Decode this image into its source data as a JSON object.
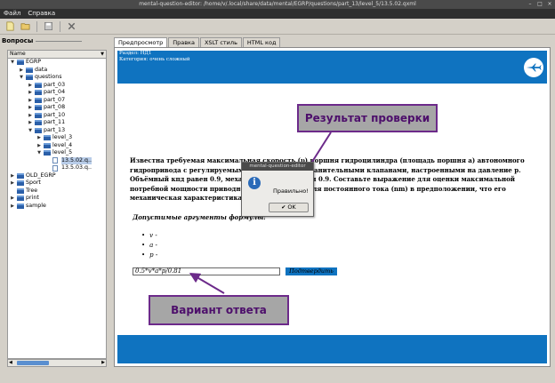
{
  "window": {
    "title": "mental-question-editor: /home/v/.local/share/data/mental/EGRP/questions/part_13/level_5/13.5.02.qxml"
  },
  "menu": [
    "Файл",
    "Справка"
  ],
  "toolbar": {
    "icons": [
      "new-file-icon",
      "open-file-icon",
      "save-icon",
      "delete-icon"
    ]
  },
  "left_panel": {
    "title": "Вопросы",
    "column": "Name",
    "tree": [
      {
        "label": "EGRP",
        "level": 0,
        "arrow": "down",
        "type": "folder"
      },
      {
        "label": "data",
        "level": 1,
        "arrow": "right",
        "type": "folder"
      },
      {
        "label": "questions",
        "level": 1,
        "arrow": "down",
        "type": "folder"
      },
      {
        "label": "part_03",
        "level": 2,
        "arrow": "right",
        "type": "folder"
      },
      {
        "label": "part_04",
        "level": 2,
        "arrow": "right",
        "type": "folder"
      },
      {
        "label": "part_07",
        "level": 2,
        "arrow": "right",
        "type": "folder"
      },
      {
        "label": "part_08",
        "level": 2,
        "arrow": "right",
        "type": "folder"
      },
      {
        "label": "part_10",
        "level": 2,
        "arrow": "right",
        "type": "folder"
      },
      {
        "label": "part_11",
        "level": 2,
        "arrow": "right",
        "type": "folder"
      },
      {
        "label": "part_13",
        "level": 2,
        "arrow": "down",
        "type": "folder"
      },
      {
        "label": "level_3",
        "level": 3,
        "arrow": "right",
        "type": "folder"
      },
      {
        "label": "level_4",
        "level": 3,
        "arrow": "right",
        "type": "folder"
      },
      {
        "label": "level_5",
        "level": 3,
        "arrow": "down",
        "type": "folder"
      },
      {
        "label": "13.5.02.q..",
        "level": 4,
        "arrow": "",
        "type": "file",
        "selected": true
      },
      {
        "label": "13.5.03.q..",
        "level": 4,
        "arrow": "",
        "type": "file"
      },
      {
        "label": "OLD_EGRP",
        "level": 0,
        "arrow": "right",
        "type": "folder"
      },
      {
        "label": "Sport",
        "level": 0,
        "arrow": "right",
        "type": "folder"
      },
      {
        "label": "Tree",
        "level": 0,
        "arrow": "",
        "type": "folder"
      },
      {
        "label": "print",
        "level": 0,
        "arrow": "right",
        "type": "folder"
      },
      {
        "label": "sample",
        "level": 0,
        "arrow": "right",
        "type": "folder"
      }
    ]
  },
  "tabs": [
    {
      "label": "Предпросмотр",
      "active": true
    },
    {
      "label": "Правка",
      "active": false
    },
    {
      "label": "XSLT стиль",
      "active": false
    },
    {
      "label": "HTML код",
      "active": false
    }
  ],
  "preview": {
    "section": "Раздел: НД1",
    "category": "Категория: очень сложный",
    "problem_line1": "Известна требуемая максимальная скорость (υ) поршня гидроцилиндра (площадь поршня a) автономного",
    "problem_line2": "гидропривода с регулируемым насосом и предохранительными клапанами, настроенными на давление p.",
    "problem_line3": "Объёмный кпд равен 0.9, механический кпд равен 0.9. Составьте выражение для оценки максимальной",
    "problem_line4": "потребной мощности приводного электродвигателя постоянного тока (nm) в предположении, что его",
    "problem_line5": "механическая характеристика жёсткая.",
    "allowed_title": "Допустимые аргументы формулы:",
    "vars": [
      "v -",
      "a -",
      "p -"
    ],
    "answer_value": "0.5*v*a*p/0.81",
    "submit_label": "Подтвердить"
  },
  "annotations": {
    "result": "Результат проверки",
    "answer": "Вариант ответа"
  },
  "dialog": {
    "title": "mental-question-editor",
    "message": "Правильно!",
    "ok_label": "OK"
  },
  "colors": {
    "accent_blue": "#0f73c0",
    "annotation_border": "#6c2a8a",
    "annotation_text": "#4d0f6b"
  }
}
